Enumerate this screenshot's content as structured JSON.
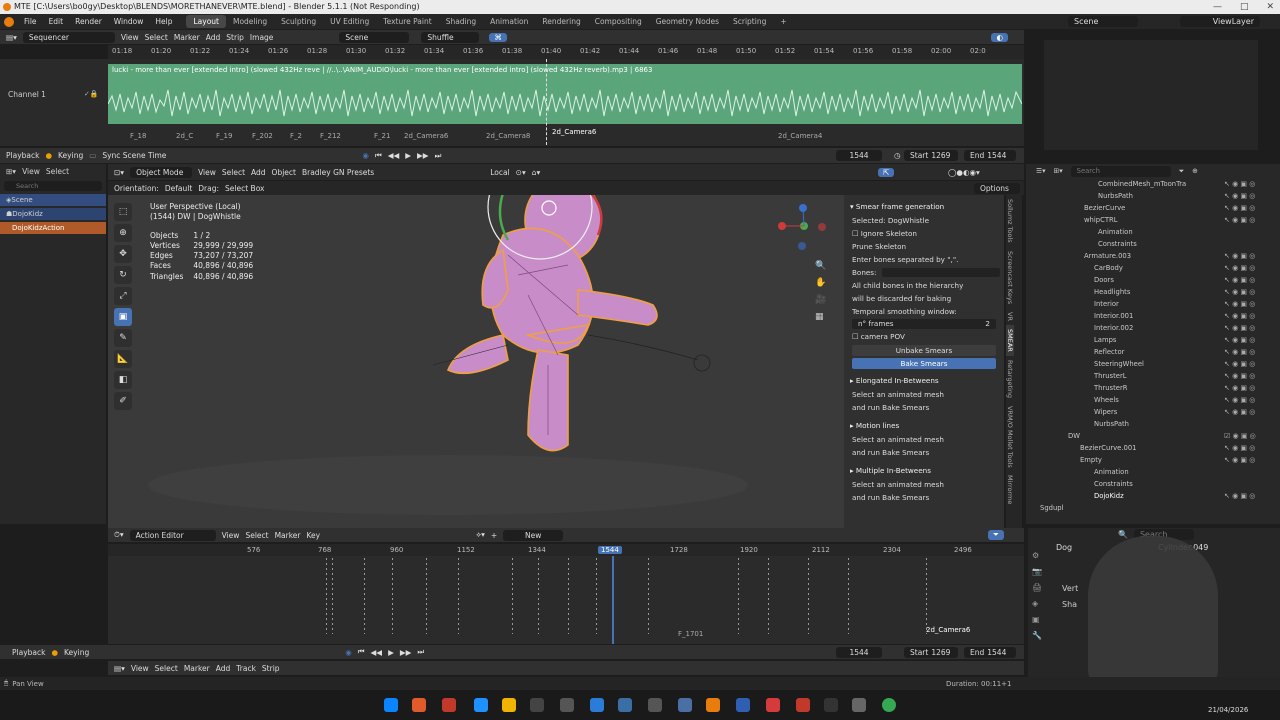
{
  "window": {
    "title": "MTE [C:\\Users\\bo0gy\\Desktop\\BLENDS\\MORETHANEVER\\MTE.blend] - Blender 5.1.1 (Not Responding)",
    "controls": [
      "—",
      "□",
      "✕"
    ]
  },
  "menubar": {
    "items": [
      "File",
      "Edit",
      "Render",
      "Window",
      "Help"
    ],
    "workspaces": [
      "Layout",
      "Modeling",
      "Sculpting",
      "UV Editing",
      "Texture Paint",
      "Shading",
      "Animation",
      "Rendering",
      "Compositing",
      "Geometry Nodes",
      "Scripting"
    ],
    "active_workspace": "Layout",
    "add": "+",
    "scene": "Scene",
    "view_layer": "ViewLayer"
  },
  "sequencer": {
    "editor": "Sequencer",
    "menus": [
      "View",
      "Select",
      "Marker",
      "Add",
      "Strip",
      "Image"
    ],
    "scene_field": "Scene",
    "shuffle": "Shuffle",
    "ruler": [
      "01:18",
      "01:20",
      "01:22",
      "01:24",
      "01:26",
      "01:28",
      "01:30",
      "01:32",
      "01:34",
      "01:36",
      "01:38",
      "01:40",
      "01:42",
      "01:44",
      "01:46",
      "01:48",
      "01:50",
      "01:52",
      "01:54",
      "01:56",
      "01:58",
      "02:00",
      "02:0"
    ],
    "channel": "Channel 1",
    "audio_label": "lucki - more than ever [extended intro] (slowed 432Hz  reve | //..\\..\\ANIM_AUDIO\\lucki - more than ever [extended intro] (slowed 432Hz reverb).mp3 | 6863",
    "markers": [
      "F_18",
      "2d_C",
      "F_19",
      "F_202",
      "F_2",
      "F_212",
      "F_21",
      "2d_Camera6",
      "2d_Camera8",
      "2d_Camera6",
      "2d_Camera4"
    ]
  },
  "playback": {
    "playback": "Playback",
    "keying": "Keying",
    "sync": "Sync Scene Time",
    "frame": "1544",
    "start_label": "Start",
    "start": "1269",
    "end_label": "End",
    "end": "1544"
  },
  "left_tree": {
    "items": [
      "Scene",
      "DojoKidz",
      "DojoKidzAction"
    ]
  },
  "viewport": {
    "mode": "Object Mode",
    "menus": [
      "View",
      "Select",
      "Add",
      "Object",
      "Bradley GN Presets"
    ],
    "orientation_label": "Orientation:",
    "orientation": "Default",
    "drag_label": "Drag:",
    "drag": "Select Box",
    "transform": "Local",
    "options": "Options",
    "persp": "User Perspective (Local)",
    "obj": "(1544) DW | DogWhistle",
    "stats": [
      {
        "k": "Objects",
        "v": "1 / 2"
      },
      {
        "k": "Vertices",
        "v": "29,999 / 29,999"
      },
      {
        "k": "Edges",
        "v": "73,207 / 73,207"
      },
      {
        "k": "Faces",
        "v": "40,896 / 40,896"
      },
      {
        "k": "Triangles",
        "v": "40,896 / 40,896"
      }
    ]
  },
  "npanel": {
    "header": "Smear frame generation",
    "selected": "Selected: DogWhistle",
    "ignore_skel": "Ignore Skeleton",
    "prune": "Prune Skeleton",
    "enter_bones": "Enter bones separated by \",\".",
    "bones": "Bones:",
    "child1": "All child bones in the hierarchy",
    "child2": "will be discarded for baking",
    "temporal": "Temporal smoothing window:",
    "nframes": "n° frames",
    "nframes_val": "2",
    "camera": "camera POV",
    "unbake": "Unbake Smears",
    "bake": "Bake Smears",
    "sec2": "Elongated In-Betweens",
    "s2a": "Select an animated mesh",
    "s2b": "and run Bake Smears",
    "sec3": "Motion lines",
    "s3a": "Select an animated mesh",
    "s3b": "and run Bake Smears",
    "sec4": "Multiple In-Betweens",
    "s4a": "Select an animated mesh",
    "s4b": "and run Bake Smears"
  },
  "vtabs": [
    "Sollumz Tools",
    "Screencast Keys",
    "VR",
    "SMEAR",
    "Retargeting",
    "VRM/O Mollet Tools",
    "Mirrorme"
  ],
  "outliner": {
    "search": "Search",
    "items": [
      "CombinedMesh_mToonTra",
      "NurbsPath",
      "BezierCurve",
      "whipCTRL",
      "Animation",
      "Constraints",
      "Armature.003",
      "CarBody",
      "Doors",
      "Headlights",
      "Interior",
      "Interior.001",
      "Interior.002",
      "Lamps",
      "Reflector",
      "SteeringWheel",
      "ThrusterL",
      "ThrusterR",
      "Wheels",
      "Wipers",
      "NurbsPath",
      "DW",
      "BezierCurve.001",
      "Empty",
      "Animation",
      "Constraints",
      "DojoKidz",
      "Sgdupl"
    ]
  },
  "props": {
    "search": "Search",
    "obj": "Dog",
    "cyl": "Cylinder.049",
    "vert": "Vert",
    "sha": "Sha"
  },
  "action": {
    "editor": "Action Editor",
    "menus": [
      "View",
      "Select",
      "Marker",
      "Key"
    ],
    "new": "New",
    "ruler": [
      "576",
      "768",
      "960",
      "1152",
      "1344",
      "1544",
      "1728",
      "1920",
      "2112",
      "2304",
      "2496"
    ],
    "current": "1544",
    "markers": [
      "2d_Camera6",
      "F_1701"
    ]
  },
  "bottom_seq": {
    "menus": [
      "View",
      "Select",
      "Marker",
      "Add",
      "Track",
      "Strip"
    ]
  },
  "status": {
    "left": "Pan View",
    "duration": "Duration: 00:11+1"
  },
  "taskbar": {
    "date": "21/04/2026"
  }
}
